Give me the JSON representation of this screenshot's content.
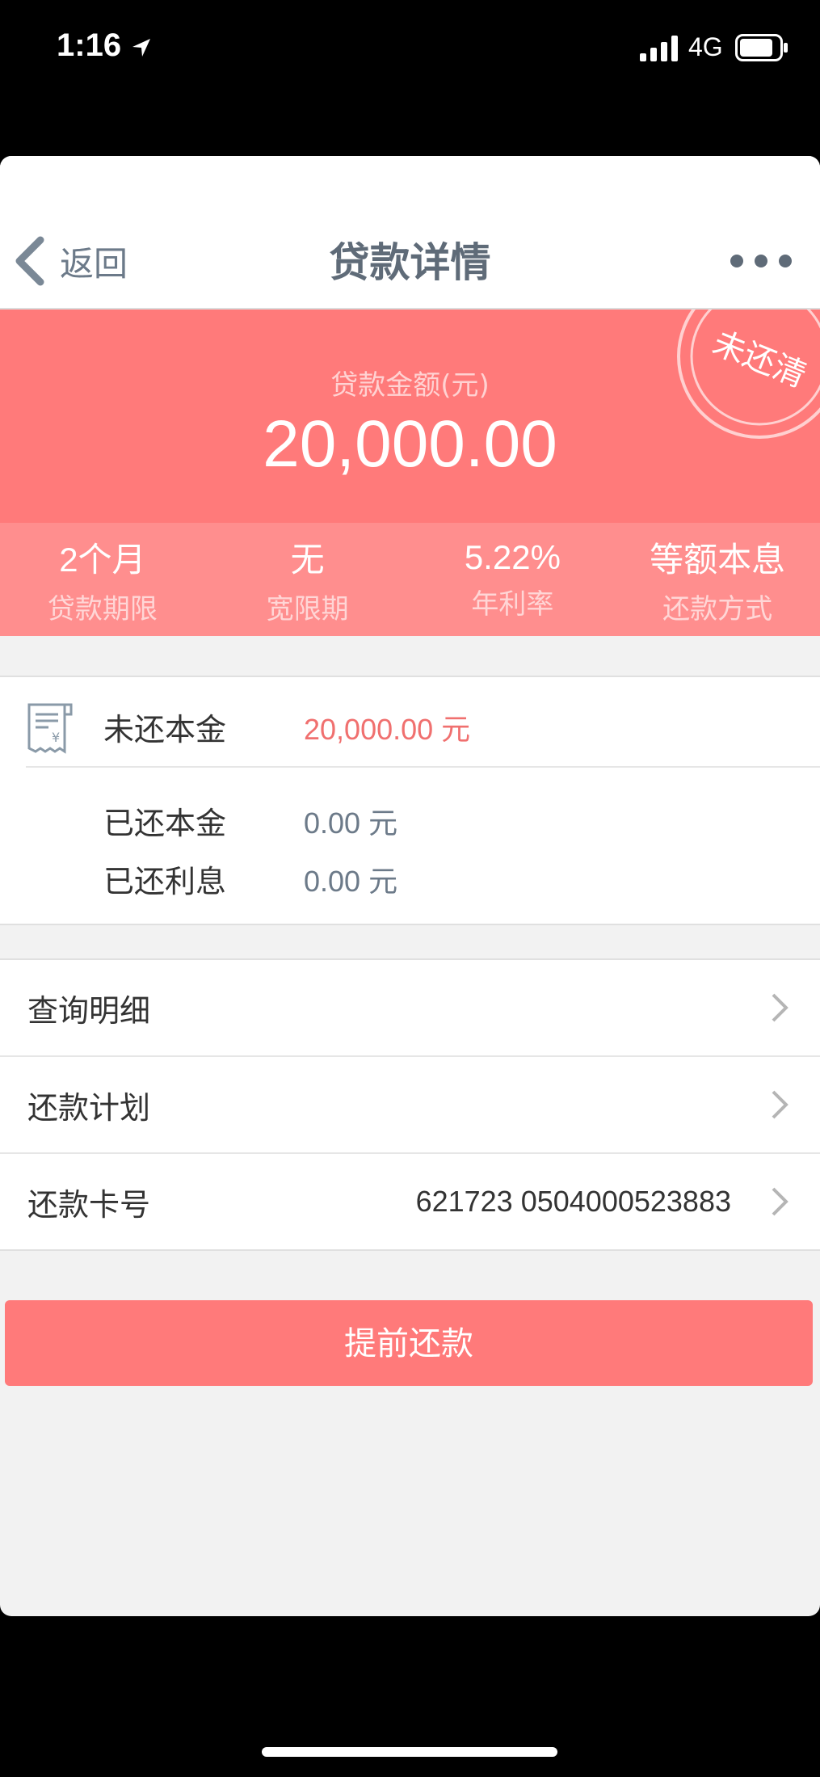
{
  "status_bar": {
    "time": "1:16",
    "network": "4G",
    "icons": [
      "location-arrow-icon",
      "signal-bars-icon",
      "battery-icon"
    ]
  },
  "nav": {
    "back_label": "返回",
    "title": "贷款详情",
    "more_icon": "more-dots-icon"
  },
  "hero": {
    "amount_label": "贷款金额(元)",
    "amount": "20,000.00",
    "stamp_text": "未还清"
  },
  "stats": [
    {
      "value": "2个月",
      "label": "贷款期限"
    },
    {
      "value": "无",
      "label": "宽限期"
    },
    {
      "value": "5.22%",
      "label": "年利率"
    },
    {
      "value": "等额本息",
      "label": "还款方式"
    }
  ],
  "principal": {
    "unpaid_label": "未还本金",
    "unpaid_value": "20,000.00 元",
    "paid_principal_label": "已还本金",
    "paid_principal_value": "0.00 元",
    "paid_interest_label": "已还利息",
    "paid_interest_value": "0.00 元"
  },
  "menu": [
    {
      "label": "查询明细",
      "value": ""
    },
    {
      "label": "还款计划",
      "value": ""
    },
    {
      "label": "还款卡号",
      "value": "621723 0504000523883"
    }
  ],
  "prepay_button": "提前还款",
  "colors": {
    "accent": "#ff7a7a",
    "accent_light": "#ff8e8e",
    "unpaid_text": "#f0706f",
    "paid_text": "#6c7a89",
    "nav_text": "#5f6b78"
  }
}
